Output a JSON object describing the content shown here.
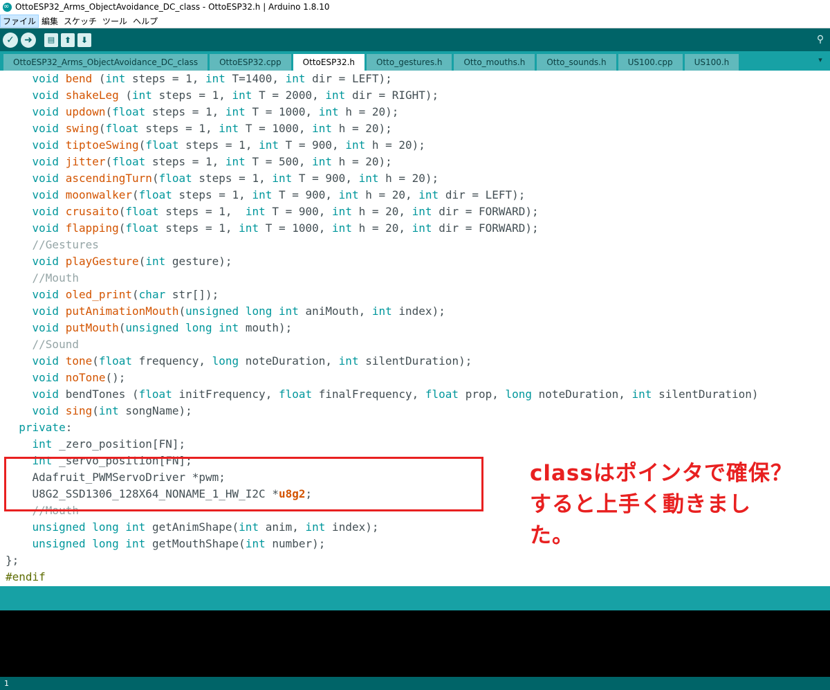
{
  "window": {
    "title": "OttoESP32_Arms_ObjectAvoidance_DC_class - OttoESP32.h | Arduino 1.8.10"
  },
  "menu": {
    "items": [
      "ファイル",
      "編集",
      "スケッチ",
      "ツール",
      "ヘルプ"
    ]
  },
  "toolbar": {
    "verify_icon": "check-icon",
    "upload_icon": "arrow-right-icon",
    "new_icon": "new-file-icon",
    "open_icon": "arrow-up-icon",
    "save_icon": "arrow-down-icon",
    "serial_icon": "magnifier-icon"
  },
  "tabs": [
    {
      "label": "OttoESP32_Arms_ObjectAvoidance_DC_class",
      "active": false
    },
    {
      "label": "OttoESP32.cpp",
      "active": false
    },
    {
      "label": "OttoESP32.h",
      "active": true
    },
    {
      "label": "Otto_gestures.h",
      "active": false
    },
    {
      "label": "Otto_mouths.h",
      "active": false
    },
    {
      "label": "Otto_sounds.h",
      "active": false
    },
    {
      "label": "US100.cpp",
      "active": false
    },
    {
      "label": "US100.h",
      "active": false
    }
  ],
  "code": [
    [
      [
        "",
        "    "
      ],
      [
        "kw",
        "void"
      ],
      [
        "",
        " "
      ],
      [
        "fn",
        "bend"
      ],
      [
        "",
        " ("
      ],
      [
        "kw",
        "int"
      ],
      [
        "",
        " steps = 1, "
      ],
      [
        "kw",
        "int"
      ],
      [
        "",
        " T=1400, "
      ],
      [
        "kw",
        "int"
      ],
      [
        "",
        " dir = LEFT);"
      ]
    ],
    [
      [
        "",
        "    "
      ],
      [
        "kw",
        "void"
      ],
      [
        "",
        " "
      ],
      [
        "fn",
        "shakeLeg"
      ],
      [
        "",
        " ("
      ],
      [
        "kw",
        "int"
      ],
      [
        "",
        " steps = 1, "
      ],
      [
        "kw",
        "int"
      ],
      [
        "",
        " T = 2000, "
      ],
      [
        "kw",
        "int"
      ],
      [
        "",
        " dir = RIGHT);"
      ]
    ],
    [
      [
        "",
        "    "
      ],
      [
        "kw",
        "void"
      ],
      [
        "",
        " "
      ],
      [
        "fn",
        "updown"
      ],
      [
        "",
        "("
      ],
      [
        "kw",
        "float"
      ],
      [
        "",
        " steps = 1, "
      ],
      [
        "kw",
        "int"
      ],
      [
        "",
        " T = 1000, "
      ],
      [
        "kw",
        "int"
      ],
      [
        "",
        " h = 20);"
      ]
    ],
    [
      [
        "",
        "    "
      ],
      [
        "kw",
        "void"
      ],
      [
        "",
        " "
      ],
      [
        "fn",
        "swing"
      ],
      [
        "",
        "("
      ],
      [
        "kw",
        "float"
      ],
      [
        "",
        " steps = 1, "
      ],
      [
        "kw",
        "int"
      ],
      [
        "",
        " T = 1000, "
      ],
      [
        "kw",
        "int"
      ],
      [
        "",
        " h = 20);"
      ]
    ],
    [
      [
        "",
        "    "
      ],
      [
        "kw",
        "void"
      ],
      [
        "",
        " "
      ],
      [
        "fn",
        "tiptoeSwing"
      ],
      [
        "",
        "("
      ],
      [
        "kw",
        "float"
      ],
      [
        "",
        " steps = 1, "
      ],
      [
        "kw",
        "int"
      ],
      [
        "",
        " T = 900, "
      ],
      [
        "kw",
        "int"
      ],
      [
        "",
        " h = 20);"
      ]
    ],
    [
      [
        "",
        "    "
      ],
      [
        "kw",
        "void"
      ],
      [
        "",
        " "
      ],
      [
        "fn",
        "jitter"
      ],
      [
        "",
        "("
      ],
      [
        "kw",
        "float"
      ],
      [
        "",
        " steps = 1, "
      ],
      [
        "kw",
        "int"
      ],
      [
        "",
        " T = 500, "
      ],
      [
        "kw",
        "int"
      ],
      [
        "",
        " h = 20);"
      ]
    ],
    [
      [
        "",
        "    "
      ],
      [
        "kw",
        "void"
      ],
      [
        "",
        " "
      ],
      [
        "fn",
        "ascendingTurn"
      ],
      [
        "",
        "("
      ],
      [
        "kw",
        "float"
      ],
      [
        "",
        " steps = 1, "
      ],
      [
        "kw",
        "int"
      ],
      [
        "",
        " T = 900, "
      ],
      [
        "kw",
        "int"
      ],
      [
        "",
        " h = 20);"
      ]
    ],
    [
      [
        "",
        "    "
      ],
      [
        "kw",
        "void"
      ],
      [
        "",
        " "
      ],
      [
        "fn",
        "moonwalker"
      ],
      [
        "",
        "("
      ],
      [
        "kw",
        "float"
      ],
      [
        "",
        " steps = 1, "
      ],
      [
        "kw",
        "int"
      ],
      [
        "",
        " T = 900, "
      ],
      [
        "kw",
        "int"
      ],
      [
        "",
        " h = 20, "
      ],
      [
        "kw",
        "int"
      ],
      [
        "",
        " dir = LEFT);"
      ]
    ],
    [
      [
        "",
        "    "
      ],
      [
        "kw",
        "void"
      ],
      [
        "",
        " "
      ],
      [
        "fn",
        "crusaito"
      ],
      [
        "",
        "("
      ],
      [
        "kw",
        "float"
      ],
      [
        "",
        " steps = 1,  "
      ],
      [
        "kw",
        "int"
      ],
      [
        "",
        " T = 900, "
      ],
      [
        "kw",
        "int"
      ],
      [
        "",
        " h = 20, "
      ],
      [
        "kw",
        "int"
      ],
      [
        "",
        " dir = FORWARD);"
      ]
    ],
    [
      [
        "",
        "    "
      ],
      [
        "kw",
        "void"
      ],
      [
        "",
        " "
      ],
      [
        "fn",
        "flapping"
      ],
      [
        "",
        "("
      ],
      [
        "kw",
        "float"
      ],
      [
        "",
        " steps = 1, "
      ],
      [
        "kw",
        "int"
      ],
      [
        "",
        " T = 1000, "
      ],
      [
        "kw",
        "int"
      ],
      [
        "",
        " h = 20, "
      ],
      [
        "kw",
        "int"
      ],
      [
        "",
        " dir = FORWARD);"
      ]
    ],
    [
      [
        "",
        "    "
      ],
      [
        "cm",
        "//Gestures"
      ]
    ],
    [
      [
        "",
        "    "
      ],
      [
        "kw",
        "void"
      ],
      [
        "",
        " "
      ],
      [
        "fn",
        "playGesture"
      ],
      [
        "",
        "("
      ],
      [
        "kw",
        "int"
      ],
      [
        "",
        " gesture);"
      ]
    ],
    [
      [
        "",
        "    "
      ],
      [
        "cm",
        "//Mouth"
      ]
    ],
    [
      [
        "",
        "    "
      ],
      [
        "kw",
        "void"
      ],
      [
        "",
        " "
      ],
      [
        "fn",
        "oled_print"
      ],
      [
        "",
        "("
      ],
      [
        "kw",
        "char"
      ],
      [
        "",
        " str[]);"
      ]
    ],
    [
      [
        "",
        "    "
      ],
      [
        "kw",
        "void"
      ],
      [
        "",
        " "
      ],
      [
        "fn",
        "putAnimationMouth"
      ],
      [
        "",
        "("
      ],
      [
        "kw",
        "unsigned"
      ],
      [
        "",
        " "
      ],
      [
        "kw",
        "long"
      ],
      [
        "",
        " "
      ],
      [
        "kw",
        "int"
      ],
      [
        "",
        " aniMouth, "
      ],
      [
        "kw",
        "int"
      ],
      [
        "",
        " index);"
      ]
    ],
    [
      [
        "",
        "    "
      ],
      [
        "kw",
        "void"
      ],
      [
        "",
        " "
      ],
      [
        "fn",
        "putMouth"
      ],
      [
        "",
        "("
      ],
      [
        "kw",
        "unsigned"
      ],
      [
        "",
        " "
      ],
      [
        "kw",
        "long"
      ],
      [
        "",
        " "
      ],
      [
        "kw",
        "int"
      ],
      [
        "",
        " mouth);"
      ]
    ],
    [
      [
        "",
        "    "
      ],
      [
        "cm",
        "//Sound"
      ]
    ],
    [
      [
        "",
        "    "
      ],
      [
        "kw",
        "void"
      ],
      [
        "",
        " "
      ],
      [
        "fn",
        "tone"
      ],
      [
        "",
        "("
      ],
      [
        "kw",
        "float"
      ],
      [
        "",
        " frequency, "
      ],
      [
        "kw",
        "long"
      ],
      [
        "",
        " noteDuration, "
      ],
      [
        "kw",
        "int"
      ],
      [
        "",
        " silentDuration);"
      ]
    ],
    [
      [
        "",
        "    "
      ],
      [
        "kw",
        "void"
      ],
      [
        "",
        " "
      ],
      [
        "fn",
        "noTone"
      ],
      [
        "",
        "();"
      ]
    ],
    [
      [
        "",
        "    "
      ],
      [
        "kw",
        "void"
      ],
      [
        "",
        " bendTones ("
      ],
      [
        "kw",
        "float"
      ],
      [
        "",
        " initFrequency, "
      ],
      [
        "kw",
        "float"
      ],
      [
        "",
        " finalFrequency, "
      ],
      [
        "kw",
        "float"
      ],
      [
        "",
        " prop, "
      ],
      [
        "kw",
        "long"
      ],
      [
        "",
        " noteDuration, "
      ],
      [
        "kw",
        "int"
      ],
      [
        "",
        " silentDuration)"
      ]
    ],
    [
      [
        "",
        "    "
      ],
      [
        "kw",
        "void"
      ],
      [
        "",
        " "
      ],
      [
        "fn",
        "sing"
      ],
      [
        "",
        "("
      ],
      [
        "kw",
        "int"
      ],
      [
        "",
        " songName);"
      ]
    ],
    [
      [
        "",
        "  "
      ],
      [
        "kw",
        "private"
      ],
      [
        "",
        ":"
      ]
    ],
    [
      [
        "",
        "    "
      ],
      [
        "kw",
        "int"
      ],
      [
        "",
        " _zero_position[FN];"
      ]
    ],
    [
      [
        "",
        "    "
      ],
      [
        "kw",
        "int"
      ],
      [
        "",
        " _servo_position[FN];"
      ]
    ],
    [
      [
        "",
        "    Adafruit_PWMServoDriver *pwm;"
      ]
    ],
    [
      [
        "",
        "    U8G2_SSD1306_128X64_NONAME_1_HW_I2C *"
      ],
      [
        "em",
        "u8g2"
      ],
      [
        "",
        ";"
      ]
    ],
    [
      [
        "",
        "    "
      ],
      [
        "cm",
        "//Mouth"
      ]
    ],
    [
      [
        "",
        "    "
      ],
      [
        "kw",
        "unsigned"
      ],
      [
        "",
        " "
      ],
      [
        "kw",
        "long"
      ],
      [
        "",
        " "
      ],
      [
        "kw",
        "int"
      ],
      [
        "",
        " getAnimShape("
      ],
      [
        "kw",
        "int"
      ],
      [
        "",
        " anim, "
      ],
      [
        "kw",
        "int"
      ],
      [
        "",
        " index);"
      ]
    ],
    [
      [
        "",
        "    "
      ],
      [
        "kw",
        "unsigned"
      ],
      [
        "",
        " "
      ],
      [
        "kw",
        "long"
      ],
      [
        "",
        " "
      ],
      [
        "kw",
        "int"
      ],
      [
        "",
        " getMouthShape("
      ],
      [
        "kw",
        "int"
      ],
      [
        "",
        " number);"
      ]
    ],
    [
      [
        "",
        "};"
      ]
    ],
    [
      [
        "pp",
        "#endif"
      ]
    ]
  ],
  "annotation": {
    "text": "classはポインタで確保？すると上手く動きました。",
    "color": "#e82020"
  },
  "footer": {
    "line_number": "1"
  },
  "colors": {
    "toolbar": "#006468",
    "tabbar": "#17a1a5",
    "keyword": "#00979c",
    "function": "#d35400",
    "comment": "#95a5a6"
  }
}
